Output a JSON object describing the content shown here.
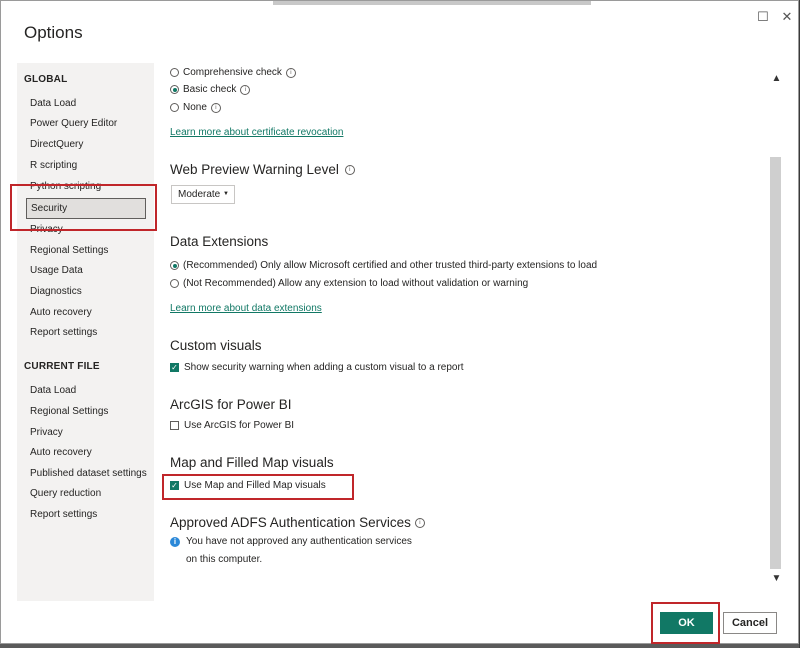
{
  "dialog": {
    "title": "Options"
  },
  "window_controls": {
    "maximize": "☐",
    "close": "✕"
  },
  "sidebar": {
    "global_heading": "GLOBAL",
    "global_items": [
      "Data Load",
      "Power Query Editor",
      "DirectQuery",
      "R scripting",
      "Python scripting",
      "Security",
      "Privacy",
      "Regional Settings",
      "Usage Data",
      "Diagnostics",
      "Auto recovery",
      "Report settings"
    ],
    "current_heading": "CURRENT FILE",
    "current_items": [
      "Data Load",
      "Regional Settings",
      "Privacy",
      "Auto recovery",
      "Published dataset settings",
      "Query reduction",
      "Report settings"
    ],
    "selected": "Security"
  },
  "cert": {
    "options": [
      "Comprehensive check",
      "Basic check",
      "None"
    ],
    "selected": "Basic check",
    "link": "Learn more about certificate revocation"
  },
  "web_preview": {
    "title": "Web Preview Warning Level",
    "value": "Moderate"
  },
  "data_ext": {
    "title": "Data Extensions",
    "options": [
      "(Recommended) Only allow Microsoft certified and other trusted third-party extensions to load",
      "(Not Recommended) Allow any extension to load without validation or warning"
    ],
    "selected": 0,
    "link": "Learn more about data extensions"
  },
  "custom_visuals": {
    "title": "Custom visuals",
    "label": "Show security warning when adding a custom visual to a report",
    "checked": true
  },
  "arcgis": {
    "title": "ArcGIS for Power BI",
    "label": "Use ArcGIS for Power BI",
    "checked": false
  },
  "map_visuals": {
    "title": "Map and Filled Map visuals",
    "label": "Use Map and Filled Map visuals",
    "checked": true
  },
  "adfs": {
    "title": "Approved ADFS Authentication Services",
    "line1": "You have not approved any authentication services",
    "line2": "on this computer."
  },
  "buttons": {
    "ok": "OK",
    "cancel": "Cancel"
  },
  "colors": {
    "accent": "#117865",
    "highlight": "#c0262a"
  }
}
